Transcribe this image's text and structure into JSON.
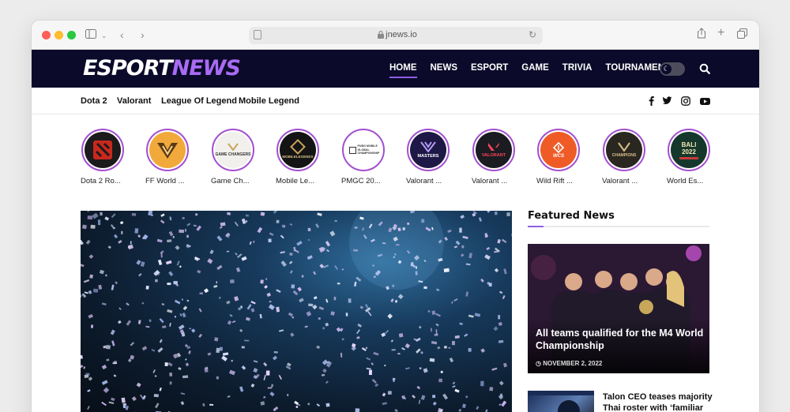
{
  "browser": {
    "url": "jnews.io"
  },
  "site": {
    "logo_part1": "ESPORT",
    "logo_part2": "NEWS",
    "nav": [
      {
        "label": "HOME",
        "active": true
      },
      {
        "label": "NEWS",
        "active": false
      },
      {
        "label": "ESPORT",
        "active": false
      },
      {
        "label": "GAME",
        "active": false
      },
      {
        "label": "TRIVIA",
        "active": false
      },
      {
        "label": "TOURNAMENT",
        "active": false
      }
    ],
    "accent_color": "#8f5ee6",
    "header_color": "#0b0a2a"
  },
  "categories": [
    "Dota 2",
    "Valorant",
    "League Of Legend",
    "Mobile Legend"
  ],
  "social": [
    "facebook-icon",
    "twitter-icon",
    "instagram-icon",
    "youtube-icon"
  ],
  "stories": [
    {
      "label": "Dota 2 Ro...",
      "badge": "",
      "bg": "#1b1b1b"
    },
    {
      "label": "FF World ...",
      "badge": "",
      "bg": "#f1a93b"
    },
    {
      "label": "Game Ch...",
      "badge": "GAME CHANGERS",
      "bg": "#f2f0ec"
    },
    {
      "label": "Mobile Le...",
      "badge": "MOBILELEGENDS",
      "bg": "#141414"
    },
    {
      "label": "PMGC 20...",
      "badge": "PUBG MOBILE GLOBAL CHAMPIONSHIP",
      "bg": "#ffffff"
    },
    {
      "label": "Valorant ...",
      "badge": "MASTERS",
      "bg": "#1e1846"
    },
    {
      "label": "Valorant ...",
      "badge": "VALORANT",
      "bg": "#1b1b22"
    },
    {
      "label": "Wild Rift ...",
      "badge": "WCS",
      "bg": "#ef5b27"
    },
    {
      "label": "Valorant ...",
      "badge": "CHAMPIONS",
      "bg": "#2a2620"
    },
    {
      "label": "World Es...",
      "badge": "BALI 2022",
      "bg": "#16382c"
    }
  ],
  "featured": {
    "section_title": "Featured News",
    "headline": "All teams qualified for the M4 World Championship",
    "date": "NOVEMBER 2, 2022",
    "second_headline": "Talon CEO teases majority Thai roster with ‘familiar"
  }
}
